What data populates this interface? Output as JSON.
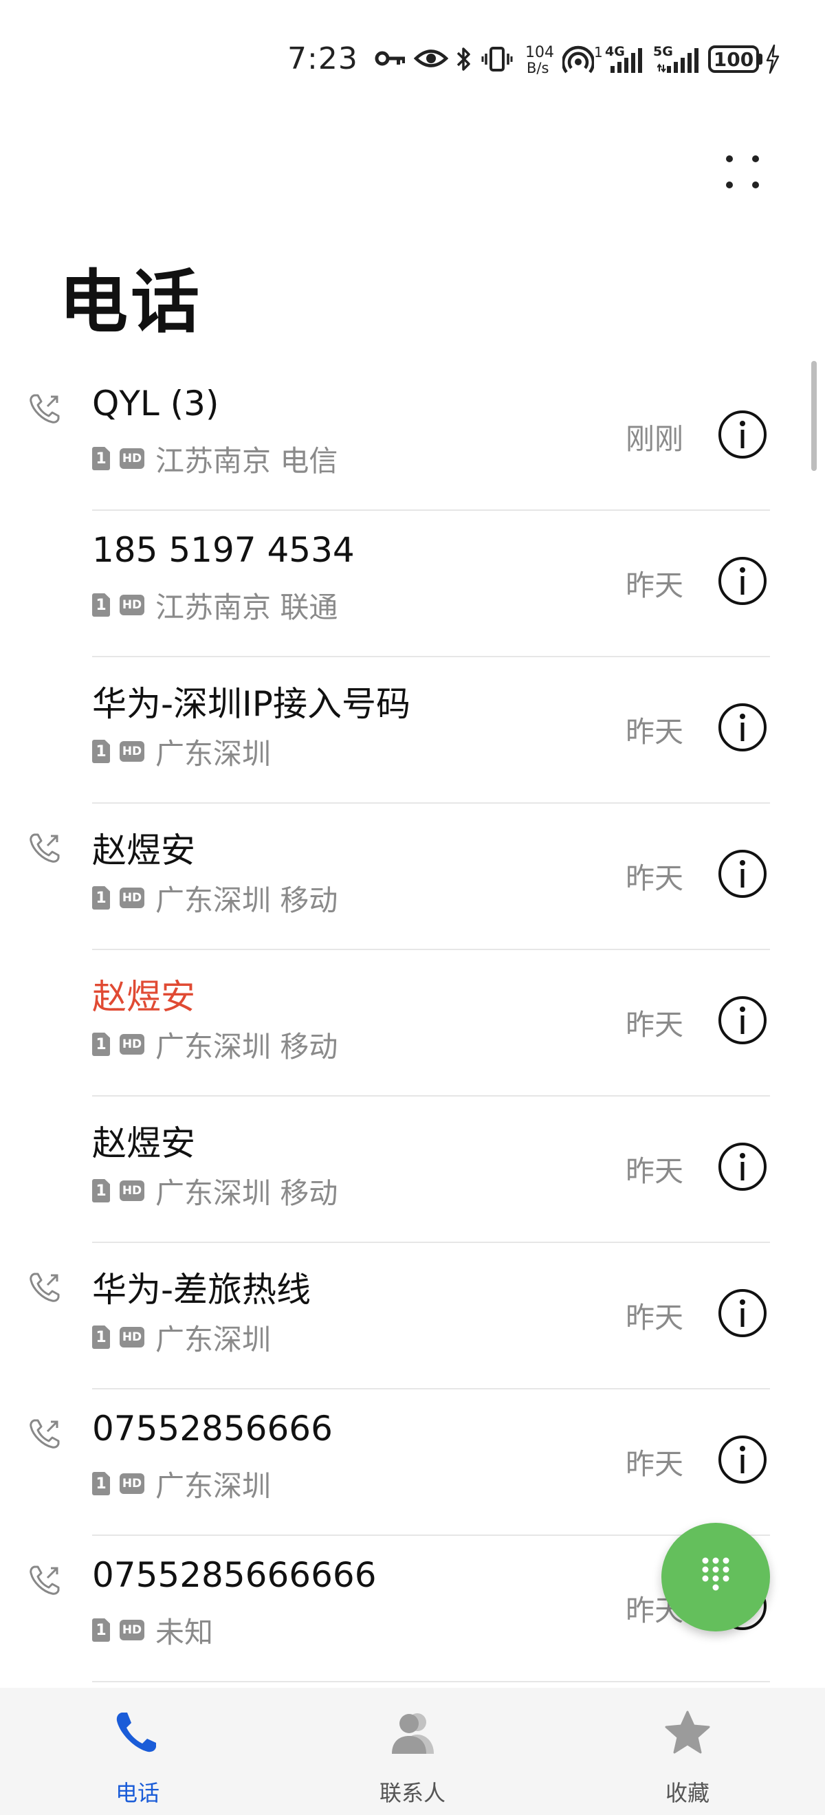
{
  "status_bar": {
    "time": "7:23",
    "icons": [
      "key-icon",
      "eye-icon",
      "bluetooth-icon",
      "vibrate-icon",
      "hotspot-icon",
      "signal-icon",
      "signal-5g-icon",
      "battery-icon",
      "charging-icon"
    ],
    "net_speed_value": "104",
    "net_speed_unit": "B/s",
    "hotspot_count": "1",
    "sim1_network": "4G",
    "sim2_network": "5G",
    "battery": "100"
  },
  "page": {
    "title": "电话"
  },
  "calls": [
    {
      "name": "QYL (3)",
      "sim": "1",
      "hd": "HD",
      "location": "江苏南京 电信",
      "time": "刚刚",
      "outgoing": true,
      "missed": false
    },
    {
      "name": "185 5197 4534",
      "sim": "1",
      "hd": "HD",
      "location": "江苏南京 联通",
      "time": "昨天",
      "outgoing": false,
      "missed": false
    },
    {
      "name": "华为-深圳IP接入号码",
      "sim": "1",
      "hd": "HD",
      "location": "广东深圳",
      "time": "昨天",
      "outgoing": false,
      "missed": false
    },
    {
      "name": "赵煜安",
      "sim": "1",
      "hd": "HD",
      "location": "广东深圳 移动",
      "time": "昨天",
      "outgoing": true,
      "missed": false
    },
    {
      "name": "赵煜安",
      "sim": "1",
      "hd": "HD",
      "location": "广东深圳 移动",
      "time": "昨天",
      "outgoing": false,
      "missed": true
    },
    {
      "name": "赵煜安",
      "sim": "1",
      "hd": "HD",
      "location": "广东深圳 移动",
      "time": "昨天",
      "outgoing": false,
      "missed": false
    },
    {
      "name": "华为-差旅热线",
      "sim": "1",
      "hd": "HD",
      "location": "广东深圳",
      "time": "昨天",
      "outgoing": true,
      "missed": false
    },
    {
      "name": "07552856666",
      "sim": "1",
      "hd": "HD",
      "location": "广东深圳",
      "time": "昨天",
      "outgoing": true,
      "missed": false
    },
    {
      "name": "0755285666666",
      "sim": "1",
      "hd": "HD",
      "location": "未知",
      "time": "昨天",
      "outgoing": true,
      "missed": false
    }
  ],
  "colors": {
    "missed": "#e04a33",
    "accent": "#1a5cd8",
    "fab": "#64bf5c"
  },
  "bottom_nav": [
    {
      "label": "电话",
      "icon": "phone-icon",
      "active": true
    },
    {
      "label": "联系人",
      "icon": "contacts-icon",
      "active": false
    },
    {
      "label": "收藏",
      "icon": "star-icon",
      "active": false
    }
  ]
}
